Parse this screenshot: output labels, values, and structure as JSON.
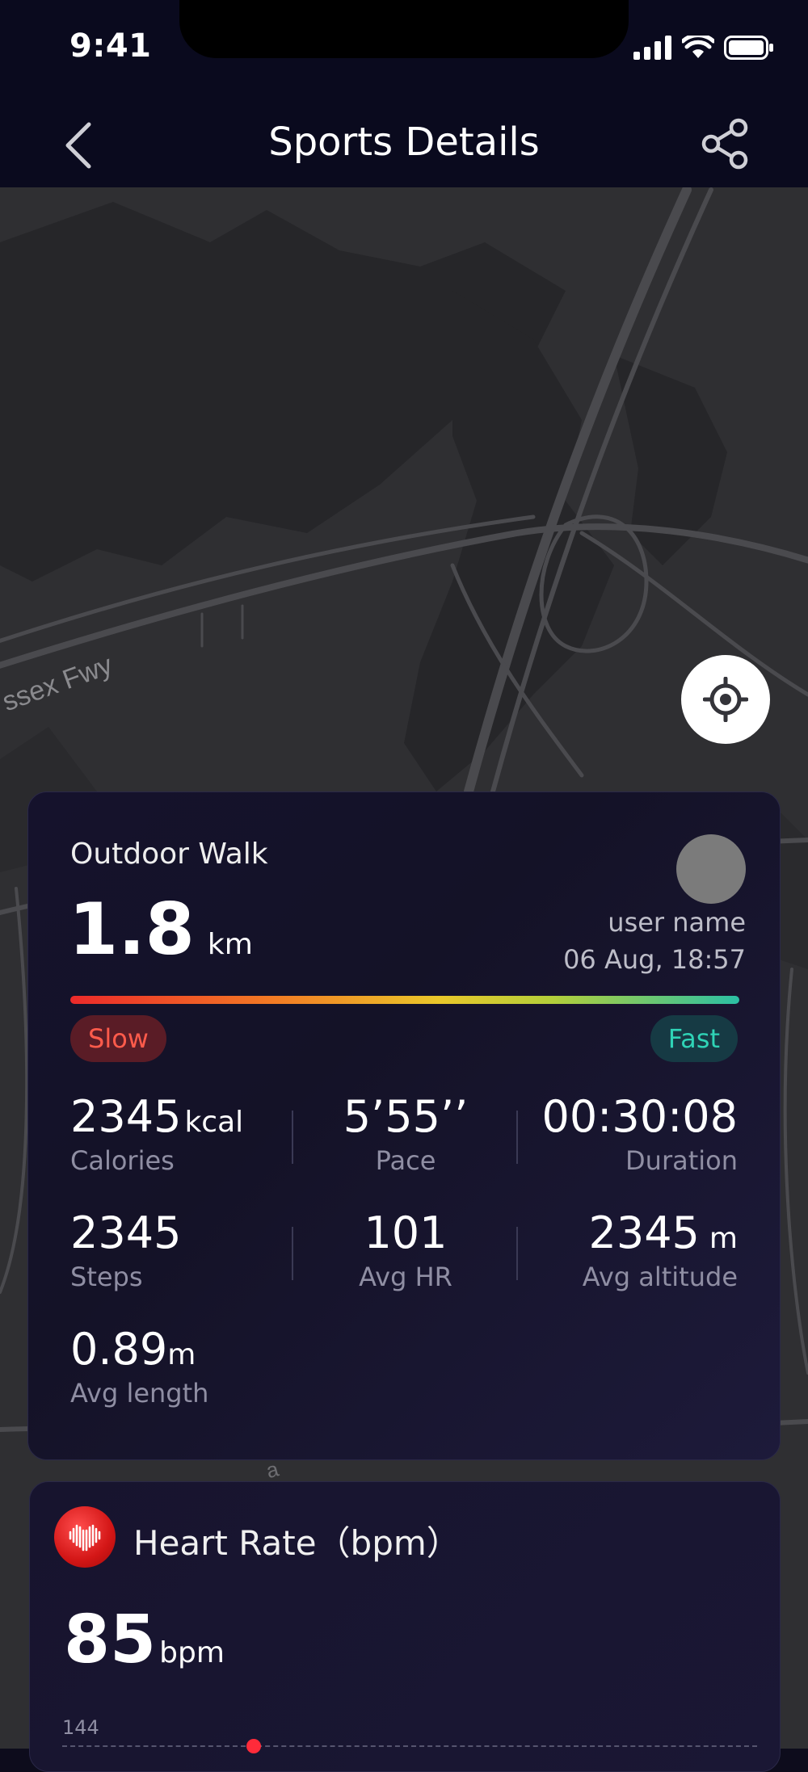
{
  "status_bar": {
    "time": "9:41"
  },
  "header": {
    "title": "Sports Details"
  },
  "map": {
    "road_label": "ssex Fwy",
    "road_label_2": "a"
  },
  "workout": {
    "type": "Outdoor Walk",
    "distance_value": "1.8",
    "distance_unit": "km",
    "user_name": "user name",
    "timestamp": "06 Aug, 18:57",
    "pace_scale": {
      "slow_label": "Slow",
      "fast_label": "Fast"
    },
    "stats": {
      "calories": {
        "value": "2345",
        "unit": "kcal",
        "label": "Calories"
      },
      "pace": {
        "value": "5’55’’",
        "label": "Pace"
      },
      "duration": {
        "value": "00:30:08",
        "label": "Duration"
      },
      "steps": {
        "value": "2345",
        "label": "Steps"
      },
      "avg_hr": {
        "value": "101",
        "label": "Avg HR"
      },
      "avg_altitude": {
        "value": "2345",
        "unit": "m",
        "label": "Avg altitude"
      },
      "avg_length": {
        "value": "0.89",
        "unit": "m",
        "label": "Avg length"
      }
    }
  },
  "heart_rate": {
    "title": "Heart Rate（bpm）",
    "value": "85",
    "unit": "bpm",
    "axis_max_label": "144"
  },
  "colors": {
    "background": "#0d0c1c",
    "slow": "#ff5b4b",
    "fast": "#2fd3b6",
    "heart": "#d31616"
  }
}
